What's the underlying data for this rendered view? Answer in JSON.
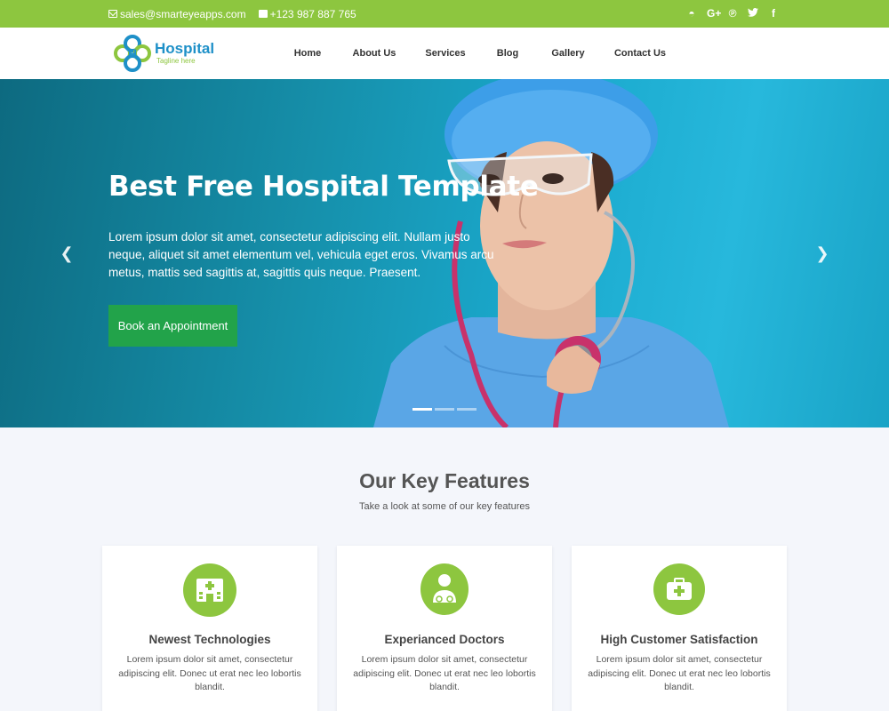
{
  "topbar": {
    "email": "sales@smarteyeapps.com",
    "phone": "+123 987 887 765",
    "social_icons": [
      "github-icon",
      "google-plus-icon",
      "pinterest-icon",
      "twitter-icon",
      "facebook-icon"
    ],
    "social_glyphs": [
      "◓",
      "G+",
      "℗",
      "🐦",
      "f"
    ]
  },
  "header": {
    "logo_name": "Hospital",
    "logo_tagline": "Tagline here",
    "nav": [
      "Home",
      "About Us",
      "Services",
      "Blog",
      "Gallery",
      "Contact Us"
    ]
  },
  "hero": {
    "title": "Best Free Hospital Template",
    "text": "Lorem ipsum dolor sit amet, consectetur adipiscing elit. Nullam justo neque, aliquet sit amet elementum vel, vehicula eget eros. Vivamus arcu metus, mattis sed sagittis at, sagittis quis neque. Praesent.",
    "button": "Book an Appointment",
    "prev_arrow": "❮",
    "next_arrow": "❯",
    "slides": 3,
    "active_slide": 1
  },
  "features": {
    "title": "Our Key Features",
    "subtitle": "Take a look at some of our key features",
    "cards": [
      {
        "icon": "hospital-icon",
        "title": "Newest Technologies",
        "text": "Lorem ipsum dolor sit amet, consectetur adipiscing elit. Donec ut erat nec leo lobortis blandit."
      },
      {
        "icon": "doctor-icon",
        "title": "Experianced Doctors",
        "text": "Lorem ipsum dolor sit amet, consectetur adipiscing elit. Donec ut erat nec leo lobortis blandit."
      },
      {
        "icon": "medical-kit-icon",
        "title": "High Customer Satisfaction",
        "text": "Lorem ipsum dolor sit amet, consectetur adipiscing elit. Donec ut erat nec leo lobortis blandit."
      }
    ]
  },
  "colors": {
    "brand_green": "#8dc63f",
    "brand_blue": "#1e90c8",
    "button_green": "#22a34a"
  }
}
